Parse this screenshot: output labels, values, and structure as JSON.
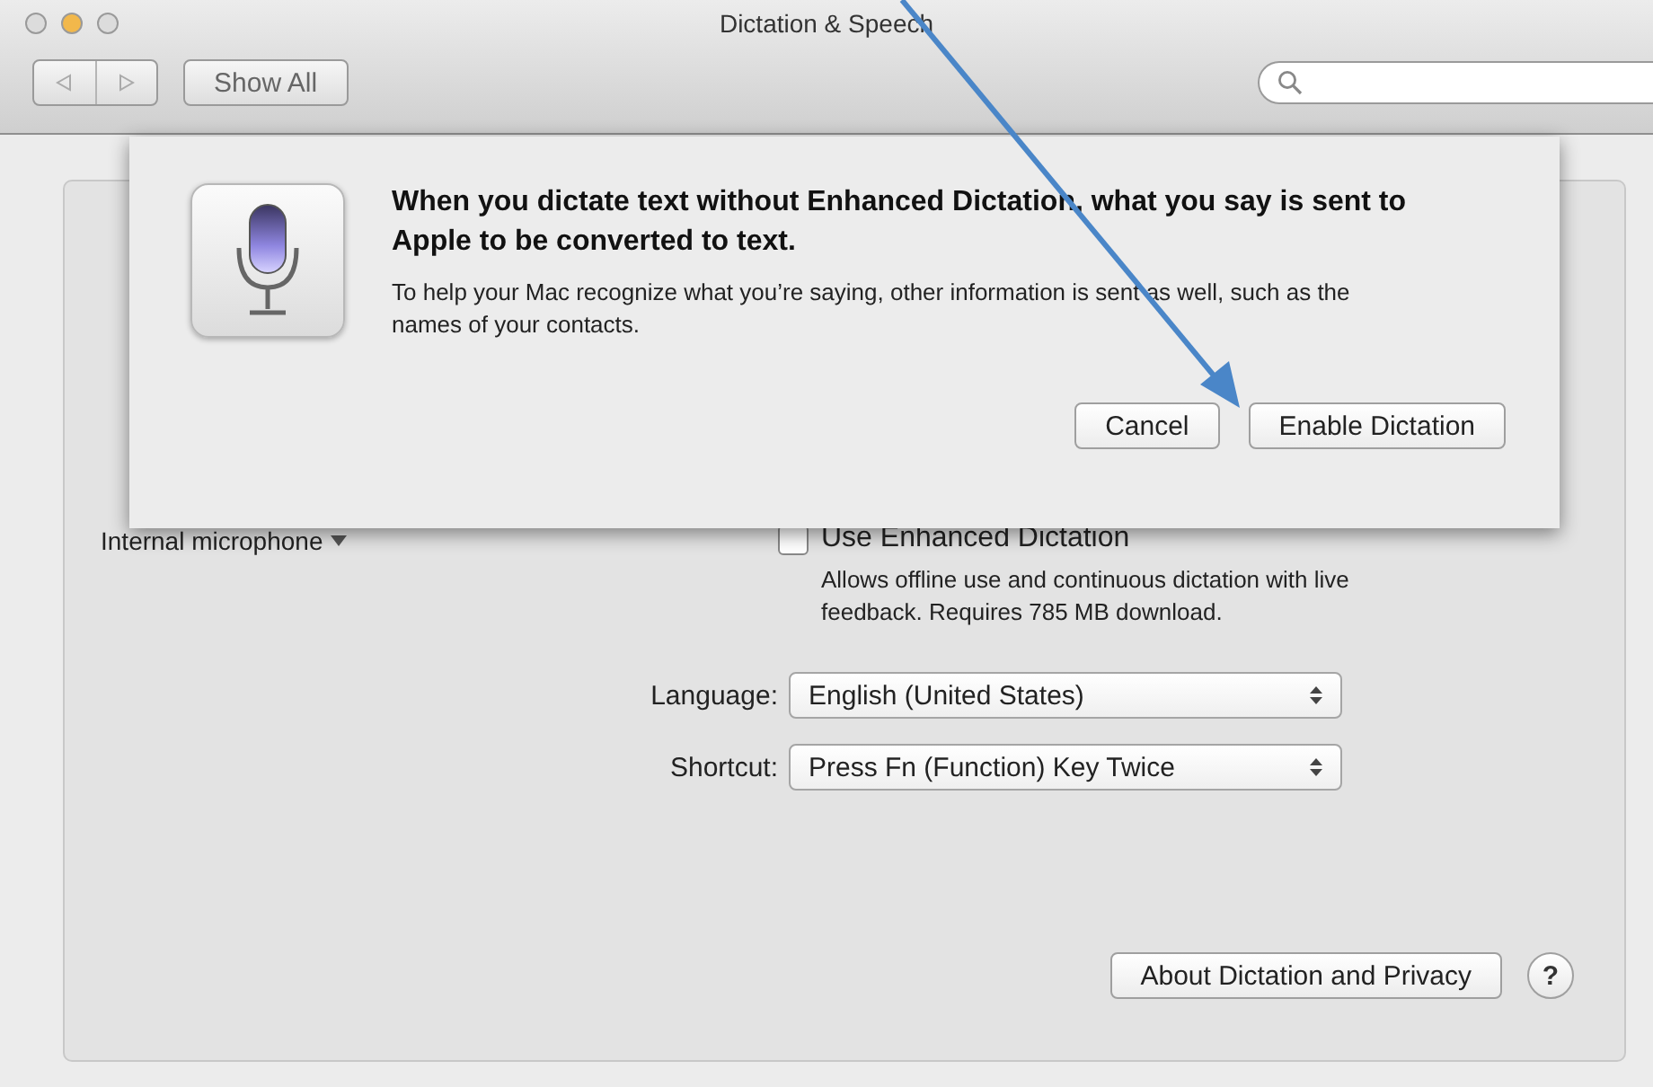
{
  "window": {
    "title": "Dictation & Speech"
  },
  "toolbar": {
    "show_all": "Show All"
  },
  "sheet": {
    "heading": "When you dictate text without Enhanced Dictation, what you say is sent to Apple to be converted to text.",
    "message": "To help your Mac recognize what you’re saying, other information is sent as well, such as the names of your contacts.",
    "buttons": [
      "Cancel",
      "Enable Dictation"
    ]
  },
  "panel": {
    "input_source": "Internal microphone",
    "enhanced": {
      "label": "Use Enhanced Dictation",
      "checked": false,
      "description": "Allows offline use and continuous dictation with live feedback. Requires 785 MB download."
    },
    "popups": [
      {
        "label": "Language:",
        "value": "English (United States)"
      },
      {
        "label": "Shortcut:",
        "value": "Press Fn (Function) Key Twice"
      }
    ],
    "about_button": "About Dictation and Privacy",
    "help_button": "?"
  }
}
